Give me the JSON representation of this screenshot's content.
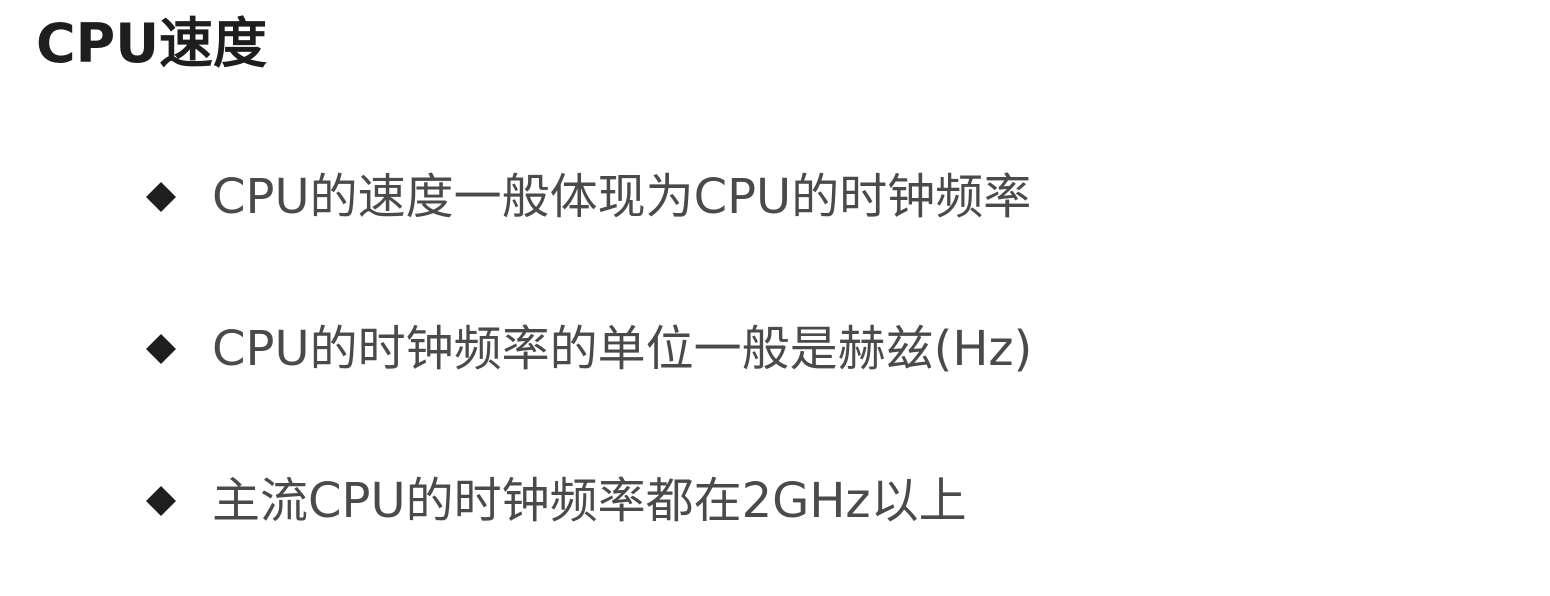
{
  "slide": {
    "title": "CPU速度",
    "bullets": [
      {
        "icon": "diamond-bullet-icon",
        "text": "CPU的速度一般体现为CPU的时钟频率"
      },
      {
        "icon": "diamond-bullet-icon",
        "text": "CPU的时钟频率的单位一般是赫兹(Hz)"
      },
      {
        "icon": "diamond-bullet-icon",
        "text": "主流CPU的时钟频率都在2GHz以上"
      }
    ],
    "colors": {
      "title": "#1e1e1e",
      "body_text": "#4a4a4a",
      "bullet": "#1e1e1e",
      "background": "#ffffff"
    }
  }
}
